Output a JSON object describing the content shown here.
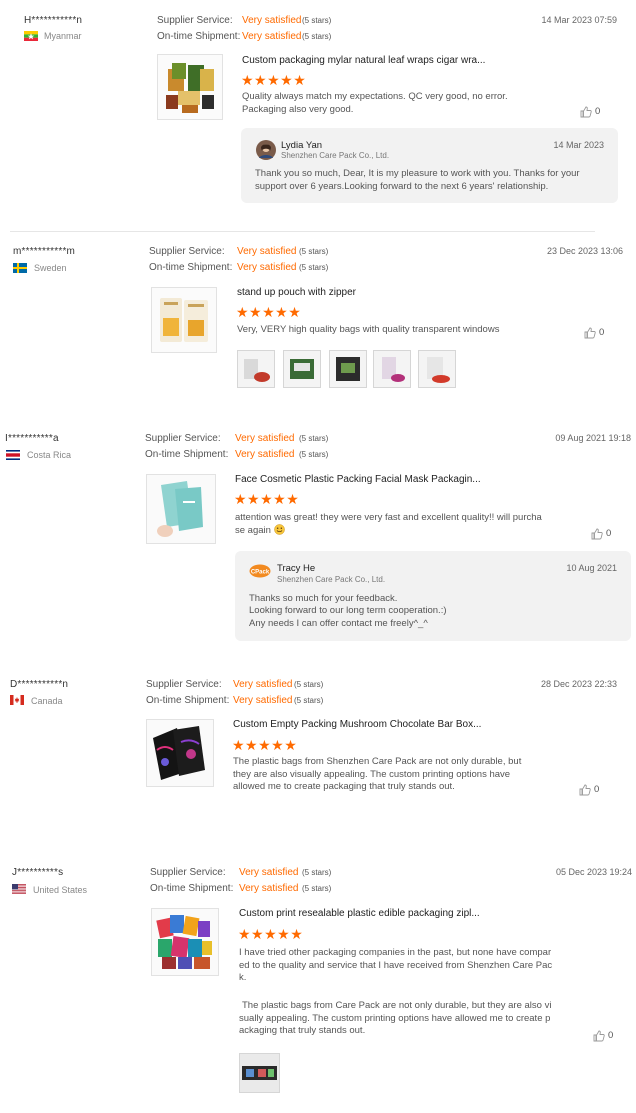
{
  "labels": {
    "supplier_service": "Supplier Service:",
    "on_time_shipment": "On-time Shipment:"
  },
  "reviews": [
    {
      "name": "H***********n",
      "country": "Myanmar",
      "supplier_rating": "Very satisfied",
      "supplier_stars": "(5 stars)",
      "shipment_rating": "Very satisfied",
      "shipment_stars": "(5 stars)",
      "date": "14 Mar 2023 07:59",
      "product_title": "Custom packaging mylar natural leaf wraps cigar wra...",
      "stars": "★★★★★",
      "text": "Quality always match my expectations. QC very good, no error. Packaging also very good.",
      "likes": "0",
      "reply": {
        "name": "Lydia Yan",
        "company": "Shenzhen Care Pack Co., Ltd.",
        "date": "14 Mar 2023",
        "text": "Thank you so much, Dear, It is my pleasure to work with you. Thanks for your support over 6 years.Looking forward to the next 6 years' relationship."
      }
    },
    {
      "name": "m***********m",
      "country": "Sweden",
      "supplier_rating": "Very satisfied",
      "supplier_stars": "(5 stars)",
      "shipment_rating": "Very satisfied",
      "shipment_stars": "(5 stars)",
      "date": "23 Dec 2023 13:06",
      "product_title": "stand up pouch with zipper",
      "stars": "★★★★★",
      "text": "Very, VERY high quality bags with quality transparent windows",
      "likes": "0"
    },
    {
      "name": "I***********a",
      "country": "Costa Rica",
      "supplier_rating": "Very satisfied",
      "supplier_stars": "(5 stars)",
      "shipment_rating": "Very satisfied",
      "shipment_stars": "(5 stars)",
      "date": "09 Aug 2021 19:18",
      "product_title": "Face Cosmetic Plastic Packing Facial Mask Packagin...",
      "stars": "★★★★★",
      "text_line1": "attention was great! they were very fast and excellent quality!! will purcha",
      "text_line2": "se again",
      "likes": "0",
      "reply": {
        "name": "Tracy He",
        "company": "Shenzhen Care Pack Co., Ltd.",
        "date": "10 Aug 2021",
        "avatar_text": "CPack",
        "line1": "Thanks so much for your feedback.",
        "line2": "Looking forward to our long term cooperation.:)",
        "line3": "Any needs I can offer contact me freely^_^"
      }
    },
    {
      "name": "D***********n",
      "country": "Canada",
      "supplier_rating": "Very satisfied",
      "supplier_stars": "(5 stars)",
      "shipment_rating": "Very satisfied",
      "shipment_stars": "(5 stars)",
      "date": "28 Dec 2023 22:33",
      "product_title": "Custom Empty Packing Mushroom Chocolate Bar Box...",
      "stars": "★★★★★",
      "text": "The plastic bags from Shenzhen Care Pack are not only durable, but they are also visually appealing. The custom printing options have allowed me to create packaging that truly stands out.",
      "likes": "0"
    },
    {
      "name": "J**********s",
      "country": "United States",
      "supplier_rating": "Very satisfied",
      "supplier_stars": "(5 stars)",
      "shipment_rating": "Very satisfied",
      "shipment_stars": "(5 stars)",
      "date": "05 Dec 2023 19:24",
      "product_title": "Custom print resealable plastic edible packaging zipl...",
      "stars": "★★★★★",
      "text_p1": "I have tried other packaging companies in the past, but none have compared to the quality and service that I have received from Shenzhen Care Pack.",
      "text_p2": "The plastic bags from Care Pack are not only durable, but they are also visually appealing. The custom printing options have allowed me to create packaging that truly stands out.",
      "likes": "0"
    }
  ]
}
